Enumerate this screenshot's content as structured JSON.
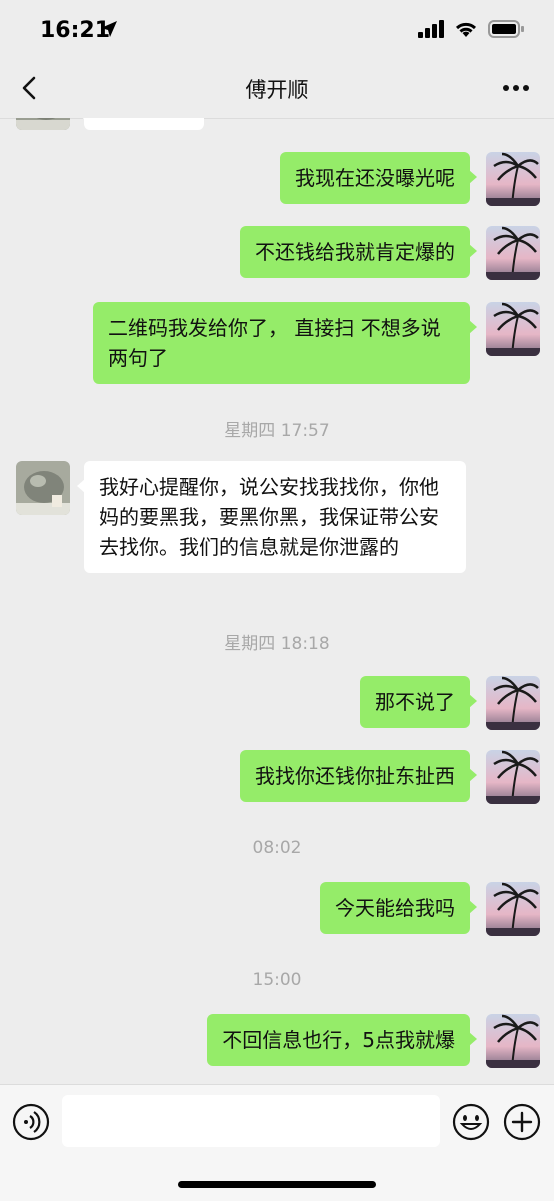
{
  "status_bar": {
    "time": "16:21"
  },
  "header": {
    "title": "傅开顺"
  },
  "messages": [
    {
      "type": "out",
      "text": "我现在还没曝光呢"
    },
    {
      "type": "out",
      "text": "不还钱给我就肯定爆的"
    },
    {
      "type": "out",
      "text": "二维码我发给你了， 直接扫  不想多说两句了"
    },
    {
      "type": "time",
      "text": "星期四 17:57"
    },
    {
      "type": "in",
      "text": "我好心提醒你，说公安找我找你，你他妈的要黑我，要黑你黑，我保证带公安去找你。我们的信息就是你泄露的"
    },
    {
      "type": "time",
      "text": "星期四 18:18"
    },
    {
      "type": "out",
      "text": "那不说了"
    },
    {
      "type": "out",
      "text": "我找你还钱你扯东扯西"
    },
    {
      "type": "time",
      "text": "08:02"
    },
    {
      "type": "out",
      "text": "今天能给我吗"
    },
    {
      "type": "time",
      "text": "15:00"
    },
    {
      "type": "out",
      "text": "不回信息也行，5点我就爆"
    }
  ],
  "input": {
    "placeholder": ""
  },
  "icons": {
    "back": "chevron-left-icon",
    "more": "ellipsis-icon",
    "voice": "voice-icon",
    "emoji": "emoji-icon",
    "plus": "plus-icon"
  },
  "colors": {
    "outgoing_bubble": "#95ec69",
    "incoming_bubble": "#ffffff",
    "background": "#ededed"
  }
}
